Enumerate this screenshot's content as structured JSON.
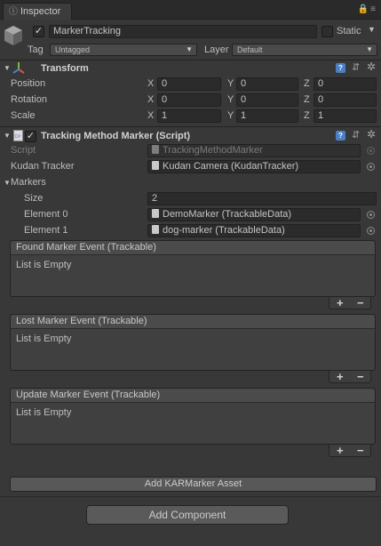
{
  "tab": {
    "label": "Inspector"
  },
  "gameobject": {
    "active": true,
    "name": "MarkerTracking",
    "static_label": "Static",
    "static_checked": false,
    "tag_label": "Tag",
    "tag_value": "Untagged",
    "layer_label": "Layer",
    "layer_value": "Default"
  },
  "transform": {
    "title": "Transform",
    "rows": [
      {
        "label": "Position",
        "x": "0",
        "y": "0",
        "z": "0"
      },
      {
        "label": "Rotation",
        "x": "0",
        "y": "0",
        "z": "0"
      },
      {
        "label": "Scale",
        "x": "1",
        "y": "1",
        "z": "1"
      }
    ],
    "axis_x": "X",
    "axis_y": "Y",
    "axis_z": "Z"
  },
  "script_component": {
    "title": "Tracking Method Marker (Script)",
    "script_label": "Script",
    "script_value": "TrackingMethodMarker",
    "tracker_label": "Kudan Tracker",
    "tracker_value": "Kudan Camera (KudanTracker)",
    "markers_label": "Markers",
    "size_label": "Size",
    "size_value": "2",
    "elements": [
      {
        "label": "Element 0",
        "value": "DemoMarker (TrackableData)"
      },
      {
        "label": "Element 1",
        "value": "dog-marker (TrackableData)"
      }
    ]
  },
  "events": [
    {
      "title": "Found Marker Event (Trackable)",
      "body": "List is Empty"
    },
    {
      "title": "Lost Marker Event (Trackable)",
      "body": "List is Empty"
    },
    {
      "title": "Update Marker Event (Trackable)",
      "body": "List is Empty"
    }
  ],
  "buttons": {
    "plus": "+",
    "minus": "−",
    "add_asset": "Add KARMarker Asset",
    "add_component": "Add Component"
  },
  "icons": {
    "lock": "lock-icon",
    "menu": "menu-icon",
    "help": "?"
  }
}
